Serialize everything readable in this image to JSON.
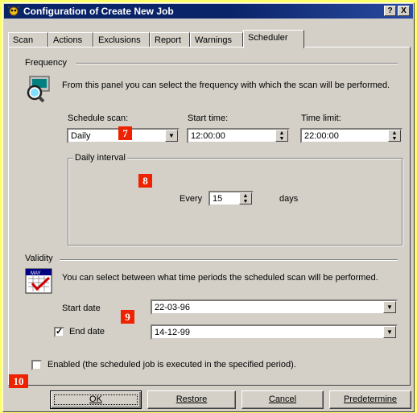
{
  "window": {
    "title": "Configuration of Create New Job",
    "help_label": "?",
    "close_label": "X"
  },
  "tabs": [
    {
      "label": "Scan"
    },
    {
      "label": "Actions"
    },
    {
      "label": "Exclusions"
    },
    {
      "label": "Report"
    },
    {
      "label": "Warnings"
    },
    {
      "label": "Scheduler",
      "active": true
    }
  ],
  "frequency": {
    "section_title": "Frequency",
    "description": "From this panel you can select the frequency with which the scan will be performed.",
    "schedule_label": "Schedule scan:",
    "schedule_value": "Daily",
    "start_time_label": "Start time:",
    "start_time_value": "12:00:00",
    "time_limit_label": "Time limit:",
    "time_limit_value": "22:00:00",
    "interval_group_title": "Daily interval",
    "every_label": "Every",
    "every_value": "15",
    "days_label": "days"
  },
  "validity": {
    "section_title": "Validity",
    "calendar_month": "MAY",
    "description": "You can select between what time periods the scheduled scan will be performed.",
    "start_date_label": "Start date",
    "start_date_value": "22-03-96",
    "end_date_label": "End date",
    "end_date_value": "14-12-99",
    "end_date_checked": true
  },
  "enabled": {
    "label": "Enabled (the scheduled job is executed in the specified period).",
    "checked": false
  },
  "buttons": {
    "ok": "OK",
    "restore": "Restore",
    "cancel": "Cancel",
    "predetermine": "Predetermine"
  },
  "callouts": {
    "c7": "7",
    "c8": "8",
    "c9": "9",
    "c10": "10"
  },
  "colors": {
    "background": "#ffff66",
    "titlebar": "#0a246a",
    "callout": "#ee2200",
    "face": "#d4d0c8"
  }
}
